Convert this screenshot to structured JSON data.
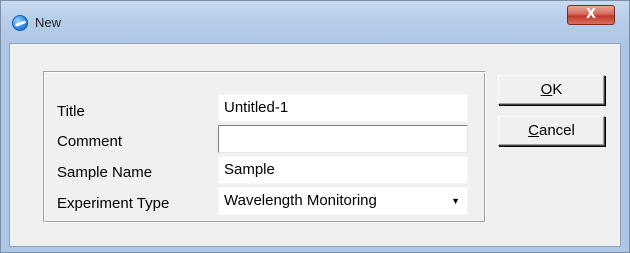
{
  "window": {
    "title": "New",
    "close_label": "X"
  },
  "form": {
    "fields": [
      {
        "label": "Title",
        "value": "Untitled-1"
      },
      {
        "label": "Comment",
        "value": ""
      },
      {
        "label": "Sample Name",
        "value": "Sample"
      },
      {
        "label": "Experiment Type",
        "value": "Wavelength Monitoring"
      }
    ],
    "dropdown_arrow": "▼"
  },
  "buttons": {
    "ok": {
      "mnemonic": "O",
      "rest": "K"
    },
    "cancel": {
      "mnemonic": "C",
      "rest": "ancel"
    }
  },
  "colors": {
    "titlebar": "#b7cde8",
    "client_bg": "#f0f0f0",
    "close_button": "#c0392b"
  }
}
